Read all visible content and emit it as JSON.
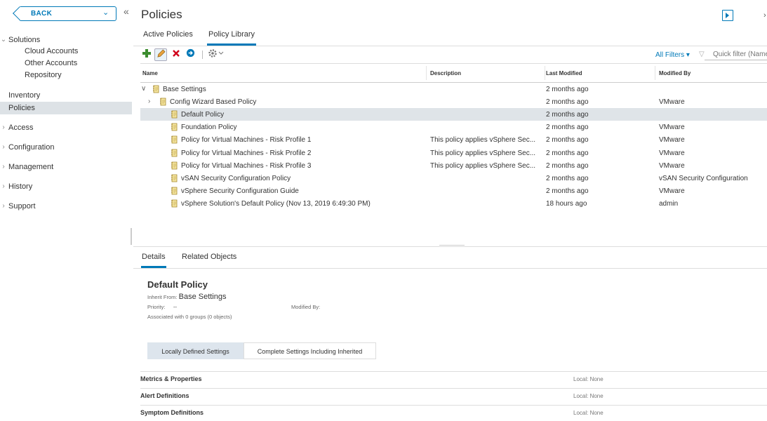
{
  "sidebar": {
    "back_label": "BACK",
    "collapse_glyph": "«",
    "sections": [
      {
        "label": "Solutions",
        "expanded": true,
        "children": [
          "Cloud Accounts",
          "Other Accounts",
          "Repository"
        ]
      },
      {
        "label": "Inventory"
      },
      {
        "label": "Policies",
        "selected": true
      },
      {
        "label": "Access"
      },
      {
        "label": "Configuration"
      },
      {
        "label": "Management"
      },
      {
        "label": "History"
      },
      {
        "label": "Support"
      }
    ]
  },
  "header": {
    "title": "Policies",
    "tabs": [
      "Active Policies",
      "Policy Library"
    ],
    "active_tab": "Policy Library"
  },
  "toolbar": {
    "icons": [
      "add-icon",
      "edit-icon",
      "delete-icon",
      "import-icon",
      "settings-icon"
    ],
    "filters_label": "All Filters",
    "quick_filter_placeholder": "Quick filter (Name"
  },
  "grid": {
    "columns": [
      "Name",
      "Description",
      "Last Modified",
      "Modified By"
    ],
    "rows": [
      {
        "name": "Base Settings",
        "description": "",
        "last_modified": "2 months ago",
        "modified_by": "",
        "level": 0,
        "twisty": "open"
      },
      {
        "name": "Config Wizard Based Policy",
        "description": "",
        "last_modified": "2 months ago",
        "modified_by": "VMware",
        "level": 1,
        "twisty": "closed"
      },
      {
        "name": "Default Policy",
        "description": "",
        "last_modified": "2 months ago",
        "modified_by": "",
        "level": 2,
        "selected": true
      },
      {
        "name": "Foundation Policy",
        "description": "",
        "last_modified": "2 months ago",
        "modified_by": "VMware",
        "level": 2
      },
      {
        "name": "Policy for Virtual Machines - Risk Profile 1",
        "description": "This policy applies vSphere Sec...",
        "last_modified": "2 months ago",
        "modified_by": "VMware",
        "level": 2
      },
      {
        "name": "Policy for Virtual Machines - Risk Profile 2",
        "description": "This policy applies vSphere Sec...",
        "last_modified": "2 months ago",
        "modified_by": "VMware",
        "level": 2
      },
      {
        "name": "Policy for Virtual Machines - Risk Profile 3",
        "description": "This policy applies vSphere Sec...",
        "last_modified": "2 months ago",
        "modified_by": "VMware",
        "level": 2
      },
      {
        "name": "vSAN Security Configuration Policy",
        "description": "",
        "last_modified": "2 months ago",
        "modified_by": "vSAN Security Configuration",
        "level": 2
      },
      {
        "name": "vSphere Security Configuration Guide",
        "description": "",
        "last_modified": "2 months ago",
        "modified_by": "VMware",
        "level": 2
      },
      {
        "name": "vSphere Solution's Default Policy (Nov 13, 2019 6:49:30 PM)",
        "description": "",
        "last_modified": "18 hours ago",
        "modified_by": "admin",
        "level": 2
      }
    ]
  },
  "details": {
    "tabs": [
      "Details",
      "Related Objects"
    ],
    "active_tab": "Details",
    "title": "Default Policy",
    "inherit_label": "Inherit From:",
    "inherit_value": "Base Settings",
    "priority_label": "Priority:",
    "priority_value": "--",
    "modified_by_label": "Modified By:",
    "associated": "Associated with 0 groups (0 objects)",
    "settings_tabs": [
      "Locally Defined Settings",
      "Complete Settings Including Inherited"
    ],
    "sections": [
      {
        "name": "Metrics & Properties",
        "value": "Local: None"
      },
      {
        "name": "Alert Definitions",
        "value": "Local: None"
      },
      {
        "name": "Symptom Definitions",
        "value": "Local: None"
      }
    ]
  },
  "colors": {
    "accent": "#0079b8",
    "selected_row": "#dfe4e8",
    "add": "#3c8d2f",
    "delete": "#d0021b"
  }
}
